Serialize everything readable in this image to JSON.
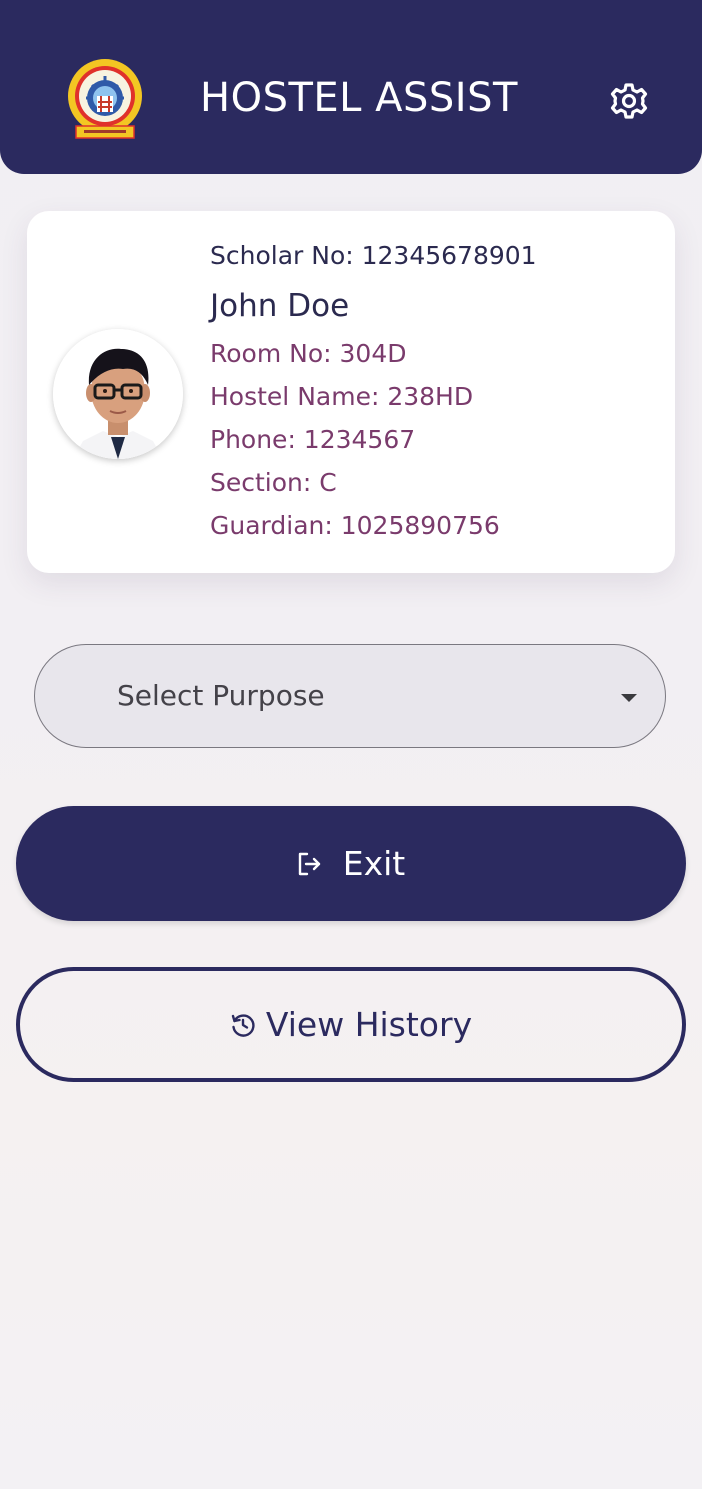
{
  "header": {
    "title": "HOSTEL ASSIST",
    "logo_icon": "institute-logo",
    "settings_icon": "gear-icon",
    "background_color": "#2b2a5f"
  },
  "profile": {
    "scholar_no": "Scholar No: 12345678901",
    "name": "John Doe",
    "room_no": "Room No: 304D",
    "hostel_name": "Hostel Name: 238HD",
    "phone": "Phone: 1234567",
    "section": "Section: C",
    "guardian": "Guardian: 1025890756",
    "avatar_icon": "student-avatar"
  },
  "purpose_select": {
    "placeholder": "Select Purpose",
    "icon": "caret-down-icon"
  },
  "exit_button": {
    "label": "Exit",
    "icon": "exit-icon",
    "color": "#2b2a5f"
  },
  "history_button": {
    "label": "View History",
    "icon": "history-icon"
  },
  "colors": {
    "primary": "#2b2a5f",
    "detail_text": "#7a3b6c",
    "name_text": "#2b2a4f"
  }
}
